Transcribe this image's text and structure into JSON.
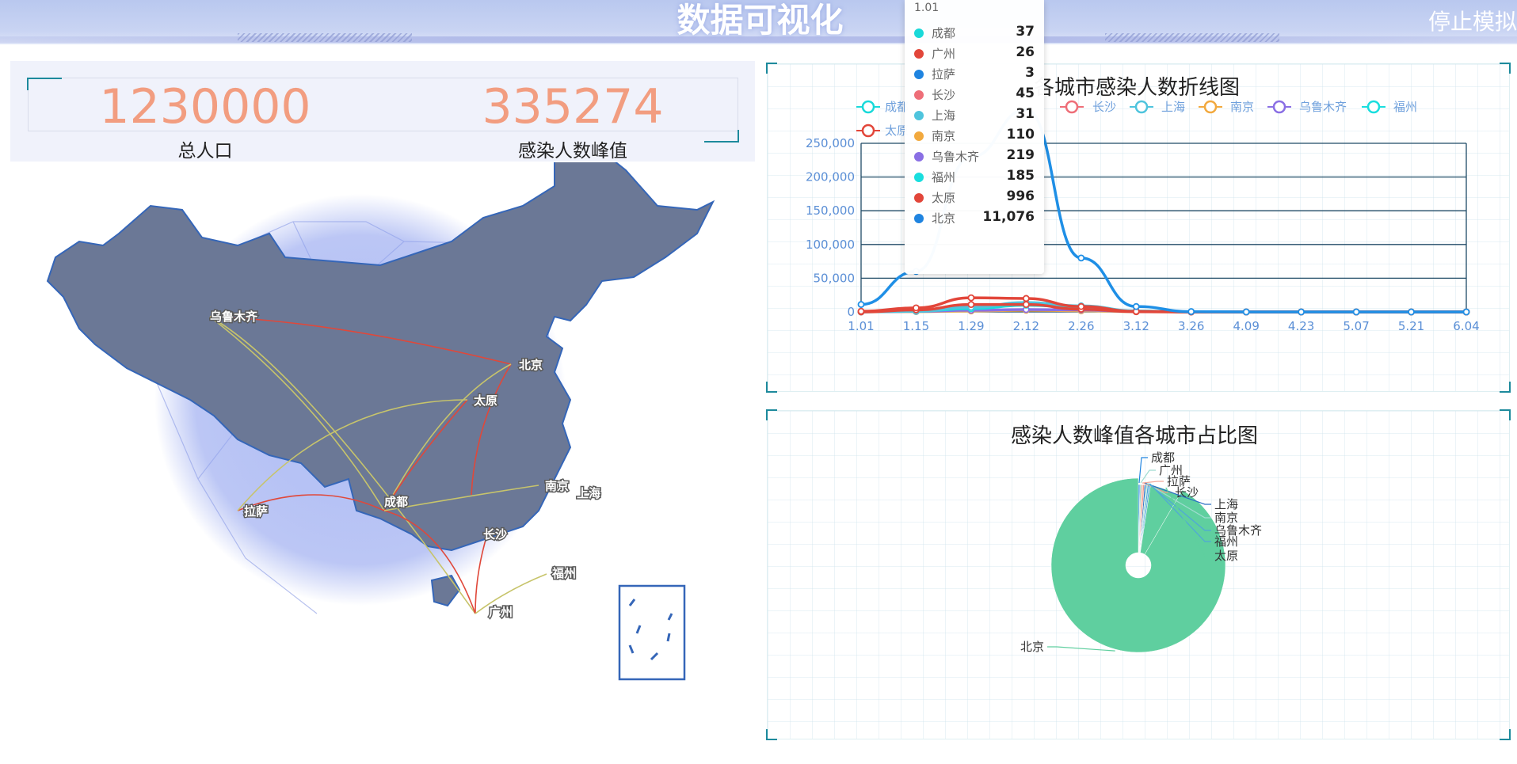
{
  "header": {
    "title": "数据可视化",
    "stop_button": "停止模拟"
  },
  "stats": {
    "total_population": "1230000",
    "total_population_label": "总人口",
    "peak_infected": "335274",
    "peak_infected_label": "感染人数峰值"
  },
  "map": {
    "cities": [
      "乌鲁木齐",
      "北京",
      "太原",
      "南京",
      "上海",
      "拉萨",
      "成都",
      "长沙",
      "福州",
      "广州"
    ]
  },
  "line_chart": {
    "title": "各城市感染人数折线图",
    "legend_visible": [
      "长沙",
      "上海",
      "南京",
      "乌鲁木齐",
      "福州"
    ],
    "legend_partial": [
      "成都",
      "太原"
    ]
  },
  "tooltip": {
    "header": "1.01",
    "rows": [
      {
        "name": "成都",
        "value": "37",
        "color": "#19d9d9"
      },
      {
        "name": "广州",
        "value": "26",
        "color": "#e2463a"
      },
      {
        "name": "拉萨",
        "value": "3",
        "color": "#1f84e0"
      },
      {
        "name": "长沙",
        "value": "45",
        "color": "#ee6e78"
      },
      {
        "name": "上海",
        "value": "31",
        "color": "#4fc4dd"
      },
      {
        "name": "南京",
        "value": "110",
        "color": "#f2a93e"
      },
      {
        "name": "乌鲁木齐",
        "value": "219",
        "color": "#8a6fe4"
      },
      {
        "name": "福州",
        "value": "185",
        "color": "#19dede"
      },
      {
        "name": "太原",
        "value": "996",
        "color": "#e2463a"
      },
      {
        "name": "北京",
        "value": "11,076",
        "color": "#1f84e0"
      }
    ]
  },
  "pie_chart": {
    "title": "感染人数峰值各城市占比图"
  },
  "chart_data": [
    {
      "type": "line",
      "title": "各城市感染人数折线图",
      "x": [
        "1.01",
        "1.15",
        "1.29",
        "2.12",
        "2.26",
        "3.12",
        "3.26",
        "4.09",
        "4.23",
        "5.07",
        "5.21",
        "6.04"
      ],
      "y_ticks": [
        "0",
        "50,000",
        "100,000",
        "150,000",
        "200,000",
        "250,000"
      ],
      "ylim": [
        0,
        250000
      ],
      "series": [
        {
          "name": "北京",
          "color": "#1f8fe6",
          "values": [
            11076,
            60000,
            230000,
            300000,
            80000,
            8000,
            500,
            0,
            0,
            0,
            0,
            0
          ]
        },
        {
          "name": "太原",
          "color": "#e2463a",
          "values": [
            996,
            6000,
            21000,
            20000,
            8000,
            800,
            0,
            0,
            0,
            0,
            0,
            0
          ]
        },
        {
          "name": "广州",
          "color": "#e2463a",
          "values": [
            26,
            3000,
            11000,
            11000,
            4000,
            300,
            0,
            0,
            0,
            0,
            0,
            0
          ]
        },
        {
          "name": "上海",
          "color": "#4fc4dd",
          "values": [
            31,
            1000,
            7000,
            14000,
            9000,
            1500,
            100,
            0,
            0,
            0,
            0,
            0
          ]
        },
        {
          "name": "福州",
          "color": "#19dede",
          "values": [
            185,
            1200,
            5000,
            10000,
            7000,
            1200,
            100,
            0,
            0,
            0,
            0,
            0
          ]
        },
        {
          "name": "乌鲁木齐",
          "color": "#8a6fe4",
          "values": [
            219,
            800,
            2500,
            3500,
            3000,
            600,
            50,
            0,
            0,
            0,
            0,
            0
          ]
        },
        {
          "name": "南京",
          "color": "#f2a93e",
          "values": [
            110,
            500,
            1500,
            2500,
            1800,
            400,
            30,
            0,
            0,
            0,
            0,
            0
          ]
        }
      ],
      "grid": true
    },
    {
      "type": "pie",
      "title": "感染人数峰值各城市占比图",
      "slices": [
        {
          "label": "成都",
          "value": 0.3,
          "color": "#1f84e0"
        },
        {
          "label": "广州",
          "value": 0.3,
          "color": "#9fdcd0"
        },
        {
          "label": "拉萨",
          "value": 0.3,
          "color": "#f1a89a"
        },
        {
          "label": "长沙",
          "value": 0.3,
          "color": "#ee9a8a"
        },
        {
          "label": "上海",
          "value": 0.3,
          "color": "#2a6fc4"
        },
        {
          "label": "南京",
          "value": 0.3,
          "color": "#9fdcd0"
        },
        {
          "label": "乌鲁木齐",
          "value": 0.3,
          "color": "#4fa7d8"
        },
        {
          "label": "福州",
          "value": 0.3,
          "color": "#4fa7d8"
        },
        {
          "label": "太原",
          "value": 6,
          "color": "#5fcf9f"
        },
        {
          "label": "北京",
          "value": 91.3,
          "color": "#5fcf9f"
        }
      ]
    }
  ]
}
